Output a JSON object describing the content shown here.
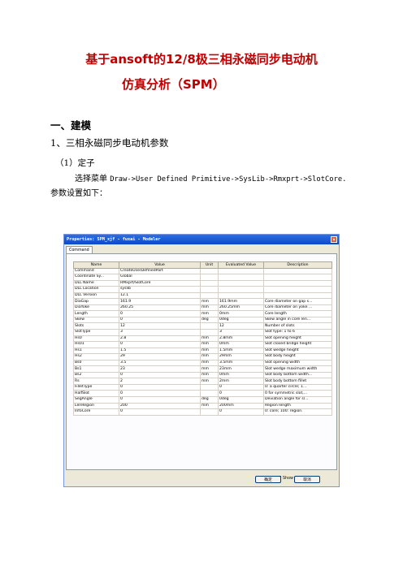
{
  "doc": {
    "title_line1": "基于ansoft的12/8极三相永磁同步电动机",
    "title_line2": "仿真分析（SPM）",
    "section1": "一、建模",
    "subsection1": "1、三相永磁同步电动机参数",
    "item1": "（1）定子",
    "para_prefix": "选择菜单",
    "para_code": "Draw->User Defined Primitive->SysLib->Rmxprt->SlotCore.",
    "para_line2": "参数设置如下："
  },
  "dialog": {
    "title": "Properties: SPM_xjf - fuxai - Modeler",
    "close_symbol": "×",
    "tab": "Command",
    "columns": [
      "Name",
      "Value",
      "Unit",
      "Evaluated Value",
      "Description"
    ],
    "rows": [
      [
        "Command",
        "CreateUserDefinedPart",
        "",
        "",
        ""
      ],
      [
        "Coordinate Sy...",
        "Global",
        "",
        "",
        ""
      ],
      [
        "DLL Name",
        "RMxprt/SlotCore",
        "",
        "",
        ""
      ],
      [
        "DLL Location",
        "syslib",
        "",
        "",
        ""
      ],
      [
        "DLL Version",
        "12.1",
        "",
        "",
        ""
      ],
      [
        "DiaGap",
        "161.9",
        "mm",
        "161.9mm",
        "Core diameter on gap s..."
      ],
      [
        "DiaYoke",
        "260.25",
        "mm",
        "260.25mm",
        "Core diameter on yoke ..."
      ],
      [
        "Length",
        "0",
        "mm",
        "0mm",
        "Core length"
      ],
      [
        "Skew",
        "0",
        "deg",
        "0deg",
        "Skew angle in core len..."
      ],
      [
        "Slots",
        "12",
        "",
        "12",
        "Number of slots"
      ],
      [
        "SlotType",
        "3",
        "",
        "3",
        "Slot type: 1 to 6"
      ],
      [
        "Hs0",
        "2.8",
        "mm",
        "2.8mm",
        "Slot opening height"
      ],
      [
        "Hs01",
        "0",
        "mm",
        "0mm",
        "Slot closed bridge height"
      ],
      [
        "Hs1",
        "1.5",
        "mm",
        "1.5mm",
        "Slot wedge height"
      ],
      [
        "Hs2",
        "29",
        "mm",
        "29mm",
        "Slot body height"
      ],
      [
        "Bs0",
        "3.5",
        "mm",
        "3.5mm",
        "Slot opening width"
      ],
      [
        "Bs1",
        "23",
        "mm",
        "23mm",
        "Slot wedge maximum width"
      ],
      [
        "Bs2",
        "0",
        "mm",
        "0mm",
        "Slot body bottom width..."
      ],
      [
        "Rs",
        "2",
        "mm",
        "2mm",
        "Slot body bottom fillet"
      ],
      [
        "FilletType",
        "0",
        "",
        "0",
        "0: a quarter circle; 1..."
      ],
      [
        "HalfSlot",
        "0",
        "",
        "0",
        "0 for symmetric slot,..."
      ],
      [
        "SegAngle",
        "0",
        "deg",
        "0deg",
        "Deviation angle for sl..."
      ],
      [
        "LenRegion",
        "200",
        "mm",
        "200mm",
        "Region length"
      ],
      [
        "InfoCore",
        "0",
        "",
        "0",
        "0: core; 100: region."
      ]
    ],
    "show_hidden": "Show Hidden",
    "ok_label": "确定",
    "cancel_label": "取消"
  }
}
